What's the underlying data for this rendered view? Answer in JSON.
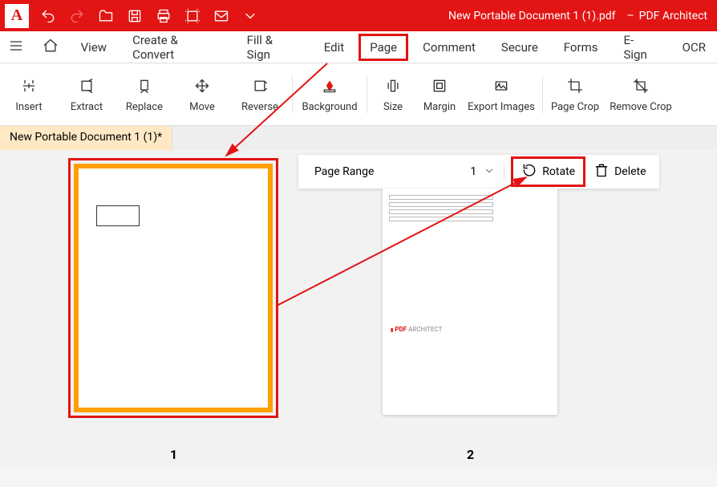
{
  "titlebar": {
    "logo_letter": "A",
    "document_title": "New Portable Document 1 (1).pdf",
    "separator": "–",
    "app_name": "PDF Architect"
  },
  "menubar": {
    "items": [
      "View",
      "Create & Convert",
      "Fill & Sign",
      "Edit",
      "Page",
      "Comment",
      "Secure",
      "Forms",
      "E-Sign",
      "OCR"
    ]
  },
  "ribbon": {
    "items": [
      "Insert",
      "Extract",
      "Replace",
      "Move",
      "Reverse",
      "Background",
      "Size",
      "Margin",
      "Export Images",
      "Page Crop",
      "Remove Crop"
    ]
  },
  "doctab": "New Portable Document 1 (1)*",
  "actionbar": {
    "page_range_label": "Page Range",
    "page_number": "1",
    "rotate_label": "Rotate",
    "delete_label": "Delete"
  },
  "thumbnails": {
    "page1_number": "1",
    "page2_number": "2",
    "page2_logo_red": "PDF",
    "page2_logo_gray": "ARCHITECT"
  }
}
